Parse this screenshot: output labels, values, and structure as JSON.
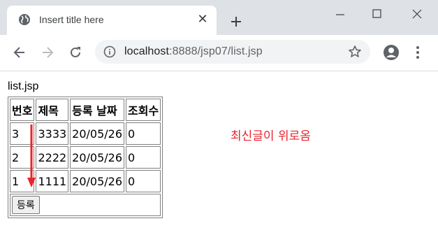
{
  "browser": {
    "tab_title": "Insert title here",
    "url_host": "localhost",
    "url_rest": ":8888/jsp07/list.jsp"
  },
  "page": {
    "heading": "list.jsp",
    "table": {
      "headers": [
        "번호",
        "제목",
        "등록 날짜",
        "조회수"
      ],
      "rows": [
        [
          "3",
          "3333",
          "20/05/26",
          "0"
        ],
        [
          "2",
          "2222",
          "20/05/26",
          "0"
        ],
        [
          "1",
          "1111",
          "20/05/26",
          "0"
        ]
      ],
      "register_button": "등록"
    },
    "annotation": "최신글이 위로옴",
    "annotation_color": "#e8242b"
  }
}
